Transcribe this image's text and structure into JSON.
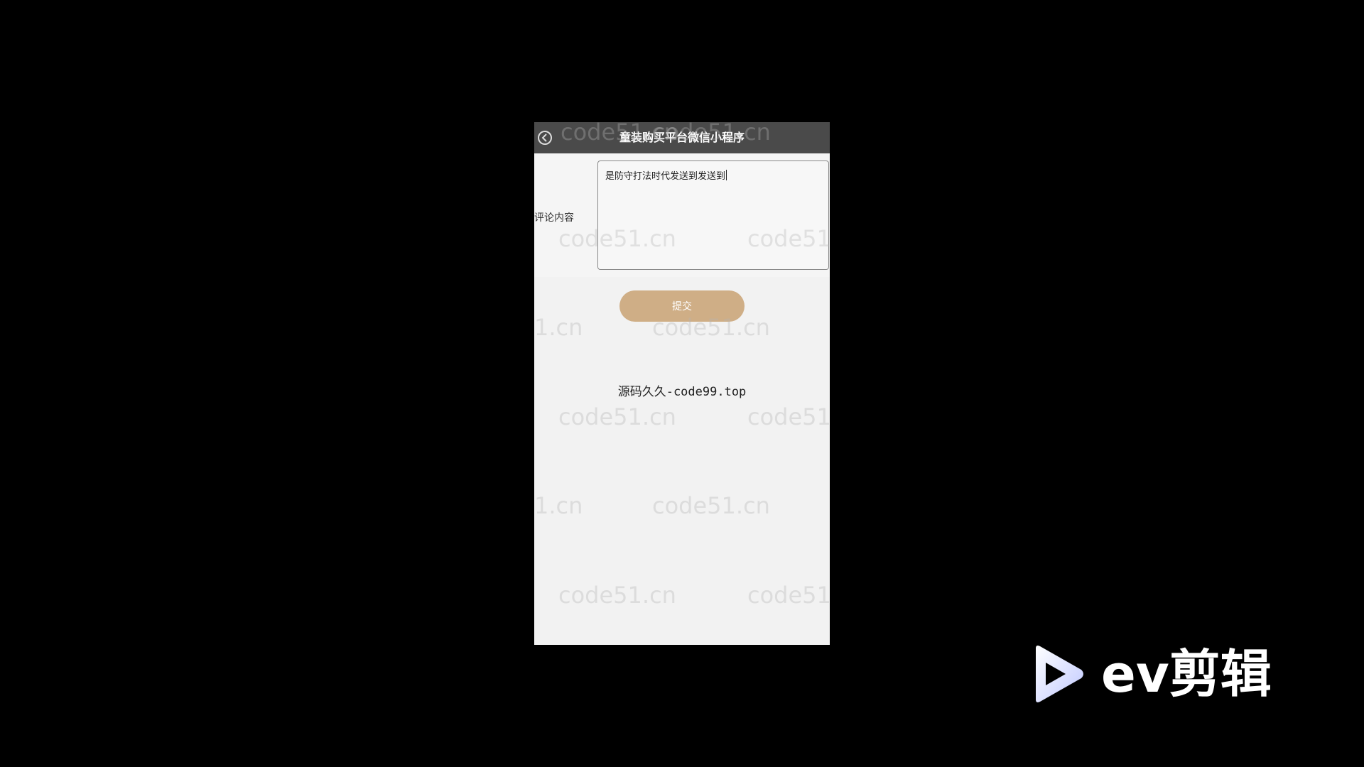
{
  "app": {
    "title": "童装购买平台微信小程序"
  },
  "form": {
    "label": "评论内容",
    "textarea_value": "是防守打法时代发送到发送到",
    "submit_label": "提交"
  },
  "footer_text": "源码久久-code99.top",
  "watermark": {
    "text": "code51.cn",
    "partial_text": "1.cn",
    "partial_text_right": "code51"
  },
  "overlay_logo": {
    "text": "ev剪辑",
    "icon": "play-icon"
  },
  "colors": {
    "navbar": "#4a4a4a",
    "submit_button": "#cfae86",
    "page_background": "#f2f2f2"
  }
}
